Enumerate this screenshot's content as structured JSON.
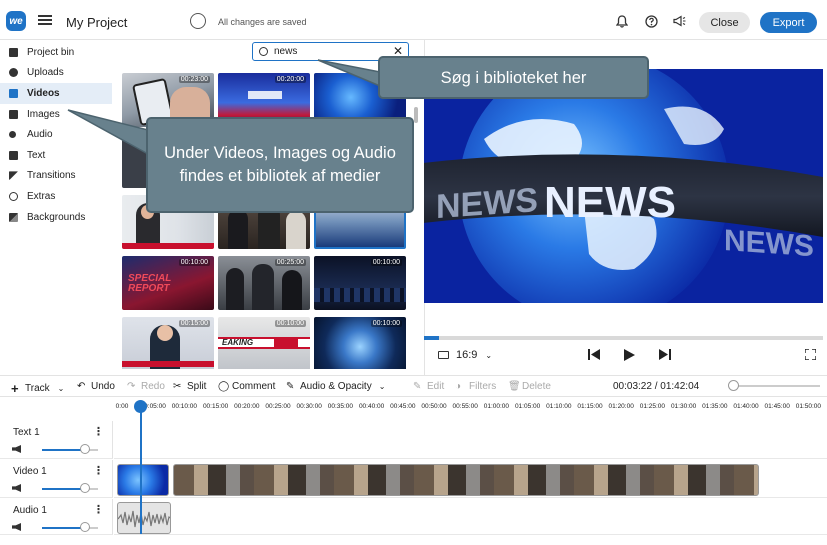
{
  "header": {
    "logo": "we",
    "project_title": "My Project",
    "save_status": "All changes are saved",
    "close_label": "Close",
    "export_label": "Export"
  },
  "sidebar": {
    "items": [
      {
        "label": "Project bin",
        "icon": "folder-icon"
      },
      {
        "label": "Uploads",
        "icon": "cloud-upload-icon"
      },
      {
        "label": "Videos",
        "icon": "video-icon",
        "active": true
      },
      {
        "label": "Images",
        "icon": "image-icon"
      },
      {
        "label": "Audio",
        "icon": "music-note-icon"
      },
      {
        "label": "Text",
        "icon": "text-icon"
      },
      {
        "label": "Transitions",
        "icon": "transition-icon"
      },
      {
        "label": "Extras",
        "icon": "smiley-icon"
      },
      {
        "label": "Backgrounds",
        "icon": "backgrounds-icon"
      }
    ]
  },
  "search": {
    "value": "news"
  },
  "library": {
    "thumbnails": [
      {
        "duration": "00:23:00",
        "scene": "phone-news"
      },
      {
        "duration": "00:20:00",
        "scene": "blue-stage"
      },
      {
        "duration": "",
        "scene": "globe-news"
      },
      {
        "duration": "",
        "scene": "dark-gray"
      },
      {
        "duration": "",
        "scene": "dark-gray"
      },
      {
        "duration": "",
        "scene": "globe-news"
      },
      {
        "duration": "",
        "scene": "anchor-woman"
      },
      {
        "duration": "",
        "scene": "press-people"
      },
      {
        "duration": "",
        "scene": "studio-blue"
      },
      {
        "duration": "00:10:00",
        "scene": "special-report"
      },
      {
        "duration": "00:25:00",
        "scene": "press-people"
      },
      {
        "duration": "00:10:00",
        "scene": "city-dark"
      },
      {
        "duration": "00:15:00",
        "scene": "anchor-man"
      },
      {
        "duration": "00:10:00",
        "scene": "breaking-banner"
      },
      {
        "duration": "00:10:00",
        "scene": "glow-globe"
      }
    ]
  },
  "callouts": {
    "search_hint": "Søg i biblioteket her",
    "library_hint": "Under Videos, Images og Audio findes et bibliotek af medier"
  },
  "preview": {
    "headline": "NEWS",
    "aspect_ratio": "16:9",
    "progress": 0.037
  },
  "timeline_toolbar": {
    "track_label": "Track",
    "undo_label": "Undo",
    "redo_label": "Redo",
    "split_label": "Split",
    "comment_label": "Comment",
    "audio_opacity_label": "Audio & Opacity",
    "edit_label": "Edit",
    "filters_label": "Filters",
    "delete_label": "Delete",
    "time_readout": "00:03:22 / 01:42:04",
    "zoom_level": 0.0
  },
  "ruler": {
    "ticks": [
      "0:00",
      "00:05:00",
      "00:10:00",
      "00:15:00",
      "00:20:00",
      "00:25:00",
      "00:30:00",
      "00:35:00",
      "00:40:00",
      "00:45:00",
      "00:50:00",
      "00:55:00",
      "01:00:00",
      "01:05:00",
      "01:10:00",
      "01:15:00",
      "01:20:00",
      "01:25:00",
      "01:30:00",
      "01:35:00",
      "01:40:00",
      "01:45:00",
      "01:50:00"
    ]
  },
  "tracks": [
    {
      "name": "Text 1",
      "volume": 0.74
    },
    {
      "name": "Video 1",
      "volume": 0.74
    },
    {
      "name": "Audio 1",
      "volume": 0.74
    }
  ],
  "colors": {
    "accent": "#1f73c6",
    "callout_bg": "#68818d",
    "news_blue": "#0a2a9e"
  }
}
